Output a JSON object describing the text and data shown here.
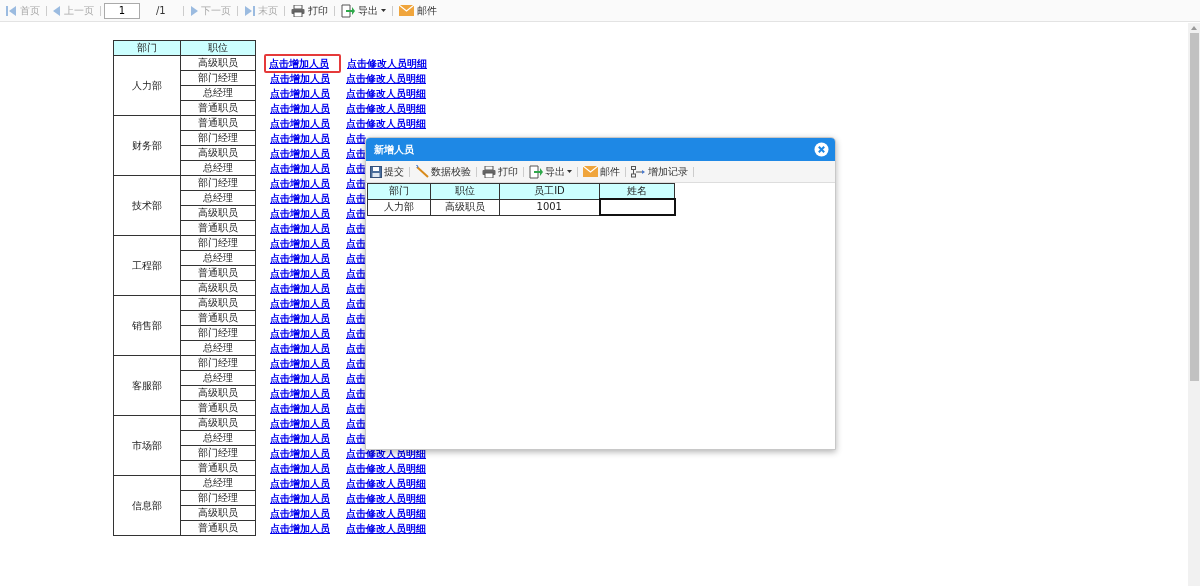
{
  "toolbar": {
    "items": [
      {
        "kind": "button",
        "label": "首页",
        "disabled": true
      },
      {
        "kind": "button",
        "label": "上一页",
        "disabled": true
      },
      {
        "kind": "page-input",
        "value": "1"
      },
      {
        "kind": "text",
        "label": "/1"
      },
      {
        "kind": "button",
        "label": "下一页",
        "disabled": true
      },
      {
        "kind": "button",
        "label": "末页",
        "disabled": true
      },
      {
        "kind": "button",
        "label": "打印",
        "disabled": false
      },
      {
        "kind": "menu",
        "label": "导出",
        "disabled": false
      },
      {
        "kind": "button",
        "label": "邮件",
        "disabled": false
      }
    ]
  },
  "report": {
    "columns": [
      "部门",
      "职位"
    ],
    "groups": [
      {
        "department": "人力部",
        "rows": [
          {
            "position": "高级职员",
            "add_link": "点击增加人员",
            "edit_link": "点击修改人员明细",
            "highlighted": true
          },
          {
            "position": "部门经理",
            "add_link": "点击增加人员",
            "edit_link": "点击修改人员明细",
            "highlighted": false
          },
          {
            "position": "总经理",
            "add_link": "点击增加人员",
            "edit_link": "点击修改人员明细",
            "highlighted": false
          },
          {
            "position": "普通职员",
            "add_link": "点击增加人员",
            "edit_link": "点击修改人员明细",
            "highlighted": false
          }
        ]
      },
      {
        "department": "财务部",
        "rows": [
          {
            "position": "普通职员",
            "add_link": "点击增加人员",
            "edit_link": "点击修改人员明细",
            "highlighted": false
          },
          {
            "position": "部门经理",
            "add_link": "点击增加人员",
            "edit_link": "点击",
            "highlighted": false
          },
          {
            "position": "高级职员",
            "add_link": "点击增加人员",
            "edit_link": "点击",
            "highlighted": false
          },
          {
            "position": "总经理",
            "add_link": "点击增加人员",
            "edit_link": "点击",
            "highlighted": false
          }
        ]
      },
      {
        "department": "技术部",
        "rows": [
          {
            "position": "部门经理",
            "add_link": "点击增加人员",
            "edit_link": "点击",
            "highlighted": false
          },
          {
            "position": "总经理",
            "add_link": "点击增加人员",
            "edit_link": "点击",
            "highlighted": false
          },
          {
            "position": "高级职员",
            "add_link": "点击增加人员",
            "edit_link": "点击",
            "highlighted": false
          },
          {
            "position": "普通职员",
            "add_link": "点击增加人员",
            "edit_link": "点击",
            "highlighted": false
          }
        ]
      },
      {
        "department": "工程部",
        "rows": [
          {
            "position": "部门经理",
            "add_link": "点击增加人员",
            "edit_link": "点击",
            "highlighted": false
          },
          {
            "position": "总经理",
            "add_link": "点击增加人员",
            "edit_link": "点击",
            "highlighted": false
          },
          {
            "position": "普通职员",
            "add_link": "点击增加人员",
            "edit_link": "点击",
            "highlighted": false
          },
          {
            "position": "高级职员",
            "add_link": "点击增加人员",
            "edit_link": "点击",
            "highlighted": false
          }
        ]
      },
      {
        "department": "销售部",
        "rows": [
          {
            "position": "高级职员",
            "add_link": "点击增加人员",
            "edit_link": "点击",
            "highlighted": false
          },
          {
            "position": "普通职员",
            "add_link": "点击增加人员",
            "edit_link": "点击",
            "highlighted": false
          },
          {
            "position": "部门经理",
            "add_link": "点击增加人员",
            "edit_link": "点击",
            "highlighted": false
          },
          {
            "position": "总经理",
            "add_link": "点击增加人员",
            "edit_link": "点击",
            "highlighted": false
          }
        ]
      },
      {
        "department": "客服部",
        "rows": [
          {
            "position": "部门经理",
            "add_link": "点击增加人员",
            "edit_link": "点击",
            "highlighted": false
          },
          {
            "position": "总经理",
            "add_link": "点击增加人员",
            "edit_link": "点击",
            "highlighted": false
          },
          {
            "position": "高级职员",
            "add_link": "点击增加人员",
            "edit_link": "点击",
            "highlighted": false
          },
          {
            "position": "普通职员",
            "add_link": "点击增加人员",
            "edit_link": "点击",
            "highlighted": false
          }
        ]
      },
      {
        "department": "市场部",
        "rows": [
          {
            "position": "高级职员",
            "add_link": "点击增加人员",
            "edit_link": "点击",
            "highlighted": false
          },
          {
            "position": "总经理",
            "add_link": "点击增加人员",
            "edit_link": "点击",
            "highlighted": false
          },
          {
            "position": "部门经理",
            "add_link": "点击增加人员",
            "edit_link": "点击修改人员明细",
            "highlighted": false
          },
          {
            "position": "普通职员",
            "add_link": "点击增加人员",
            "edit_link": "点击修改人员明细",
            "highlighted": false
          }
        ]
      },
      {
        "department": "信息部",
        "rows": [
          {
            "position": "总经理",
            "add_link": "点击增加人员",
            "edit_link": "点击修改人员明细",
            "highlighted": false
          },
          {
            "position": "部门经理",
            "add_link": "点击增加人员",
            "edit_link": "点击修改人员明细",
            "highlighted": false
          },
          {
            "position": "高级职员",
            "add_link": "点击增加人员",
            "edit_link": "点击修改人员明细",
            "highlighted": false
          },
          {
            "position": "普通职员",
            "add_link": "点击增加人员",
            "edit_link": "点击修改人员明细",
            "highlighted": false
          }
        ]
      }
    ]
  },
  "dialog": {
    "title": "新增人员",
    "toolbar": [
      {
        "kind": "button",
        "label": "提交"
      },
      {
        "kind": "button",
        "label": "数据校验"
      },
      {
        "kind": "button",
        "label": "打印"
      },
      {
        "kind": "menu",
        "label": "导出"
      },
      {
        "kind": "button",
        "label": "邮件"
      },
      {
        "kind": "button",
        "label": "增加记录"
      }
    ],
    "grid": {
      "columns": [
        "部门",
        "职位",
        "员工ID",
        "姓名"
      ],
      "rows": [
        {
          "cells": [
            {
              "text": "人力部",
              "selected": false
            },
            {
              "text": "高级职员",
              "selected": false
            },
            {
              "text": "1001",
              "selected": false
            },
            {
              "selected": true
            }
          ]
        }
      ]
    }
  }
}
